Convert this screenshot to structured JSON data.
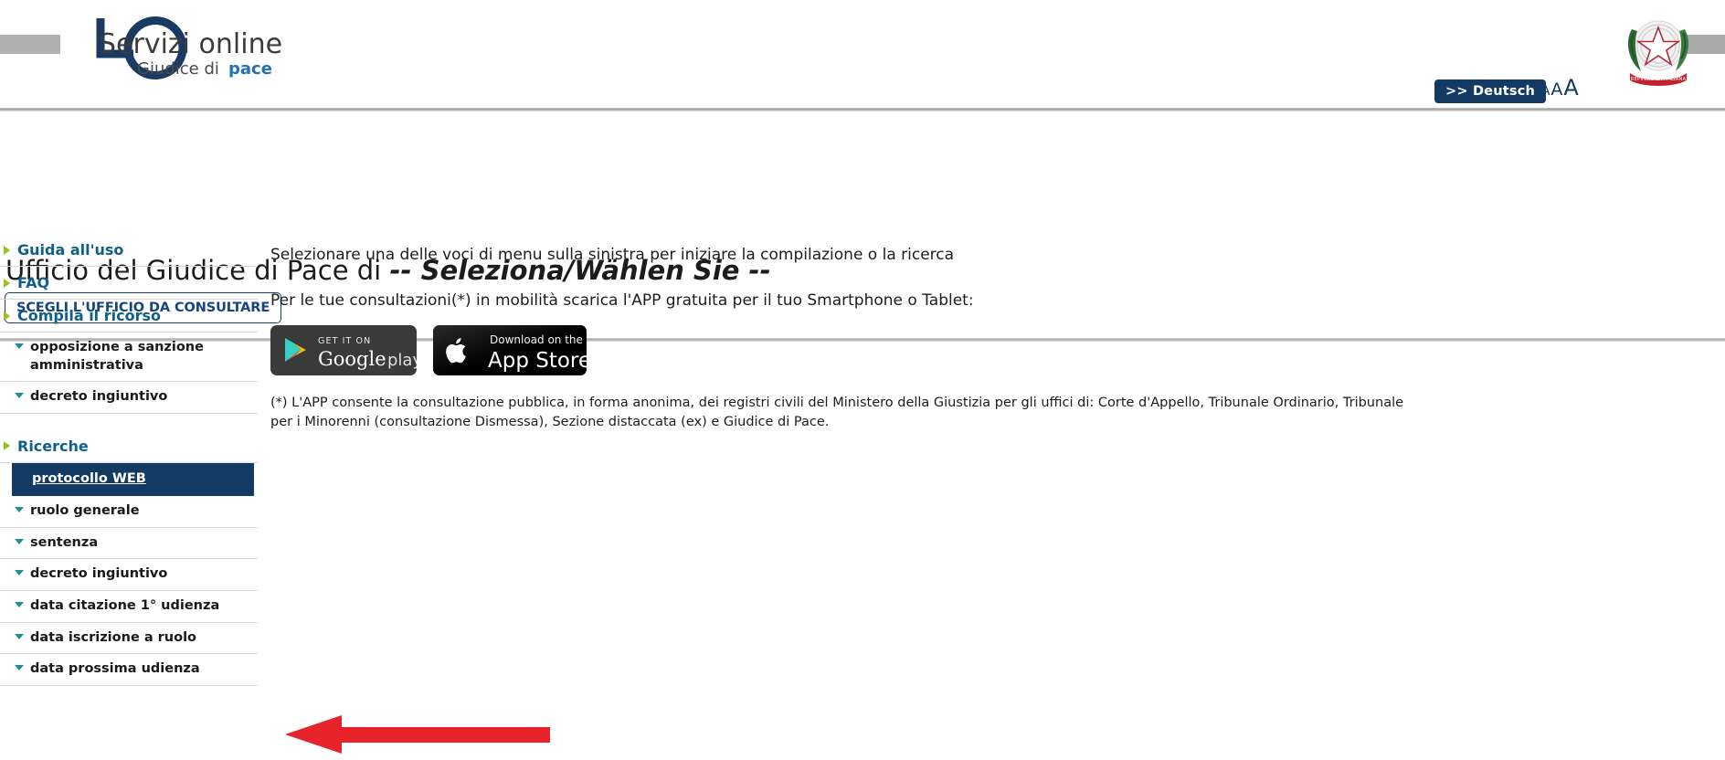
{
  "header": {
    "logo": {
      "brand_line1": "Servizi online",
      "brand_line2_a": "Giudice di ",
      "brand_line2_b": "pace",
      "mark_letter": "G",
      "colors": {
        "navy": "#1b3a63",
        "dark": "#3c3c3c",
        "blue": "#2170b8",
        "gray_bar": "#b0b0b0"
      }
    },
    "lang_button_label": ">> Deutsch",
    "font_sizer": {
      "sizes": [
        "A",
        "A",
        "A",
        "A"
      ],
      "name": "font-size-selector"
    },
    "emblem_alt": "Emblema della Repubblica Italiana"
  },
  "title": {
    "prefix": "Ufficio del Giudice di Pace di ",
    "office": "-- Seleziona/Wählen Sie --",
    "choose_office_button": "SCEGLI L'UFFICIO DA CONSULTARE"
  },
  "sidebar": {
    "items": [
      {
        "label": "Guida all'uso",
        "type": "top"
      },
      {
        "label": "FAQ",
        "type": "top"
      },
      {
        "label": "Compila il ricorso",
        "type": "top"
      },
      {
        "label": "opposizione a sanzione amministrativa",
        "type": "sub"
      },
      {
        "label": "decreto ingiuntivo",
        "type": "sub"
      },
      {
        "label": "Ricerche",
        "type": "top"
      },
      {
        "label": "protocollo WEB",
        "type": "sub",
        "active": true
      },
      {
        "label": "ruolo generale",
        "type": "sub"
      },
      {
        "label": "sentenza",
        "type": "sub"
      },
      {
        "label": "decreto ingiuntivo",
        "type": "sub"
      },
      {
        "label": "data citazione 1° udienza",
        "type": "sub"
      },
      {
        "label": "data iscrizione a ruolo",
        "type": "sub"
      },
      {
        "label": "data prossima udienza",
        "type": "sub"
      }
    ]
  },
  "main": {
    "intro": "Selezionare una delle voci di menu sulla sinistra per iniziare la compilazione o la ricerca",
    "mobile_prompt": "Per le tue consultazioni(*) in mobilità scarica l'APP gratuita per il tuo Smartphone o Tablet:",
    "badges": [
      {
        "name": "google-play-badge",
        "top_text": "GET IT ON",
        "main_text_a": "Google",
        "main_text_b": "play"
      },
      {
        "name": "app-store-badge",
        "top_text": "Download on the",
        "main_text": "App Store"
      }
    ],
    "footnote": "(*) L'APP consente la consultazione pubblica, in forma anonima, dei registri civili del Ministero della Giustizia per gli uffici di: Corte d'Appello, Tribunale Ordinario, Tribunale per i Minorenni (consultazione Dismessa), Sezione distaccata (ex) e Giudice di Pace."
  },
  "annotation": {
    "arrow": {
      "name": "red-arrow-annotation",
      "direction": "left",
      "color": "#e8222a"
    }
  }
}
